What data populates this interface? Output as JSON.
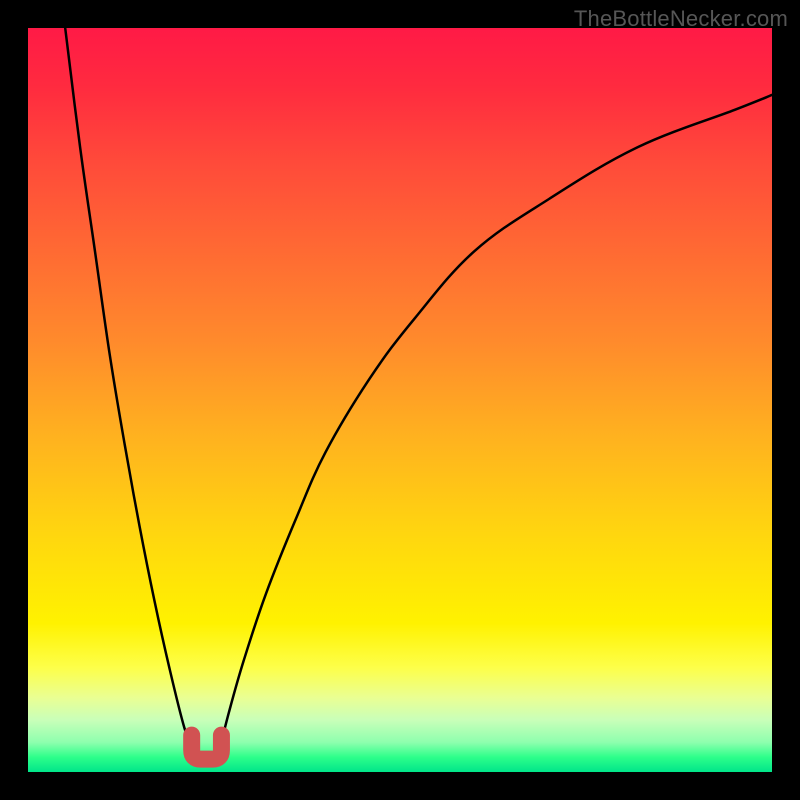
{
  "watermark": "TheBottleNecker.com",
  "chart_data": {
    "type": "line",
    "title": "",
    "xlabel": "",
    "ylabel": "",
    "xlim": [
      0,
      100
    ],
    "ylim": [
      0,
      100
    ],
    "series": [
      {
        "name": "left-curve",
        "x": [
          5,
          7,
          9,
          11,
          13,
          15,
          17,
          19,
          21,
          22.5
        ],
        "values": [
          100,
          84,
          70,
          56,
          44,
          33,
          23,
          14,
          6,
          2
        ]
      },
      {
        "name": "right-curve",
        "x": [
          25.5,
          27,
          29,
          32,
          36,
          40,
          46,
          52,
          60,
          70,
          82,
          95,
          100
        ],
        "values": [
          2,
          8,
          15,
          24,
          34,
          43,
          53,
          61,
          70,
          77,
          84,
          89,
          91
        ]
      }
    ],
    "valley": {
      "x_center": 24,
      "y": 2,
      "width": 4
    },
    "colors": {
      "curve": "#000000",
      "marker_fill": "#d15252",
      "marker_stroke": "#b84848"
    }
  }
}
